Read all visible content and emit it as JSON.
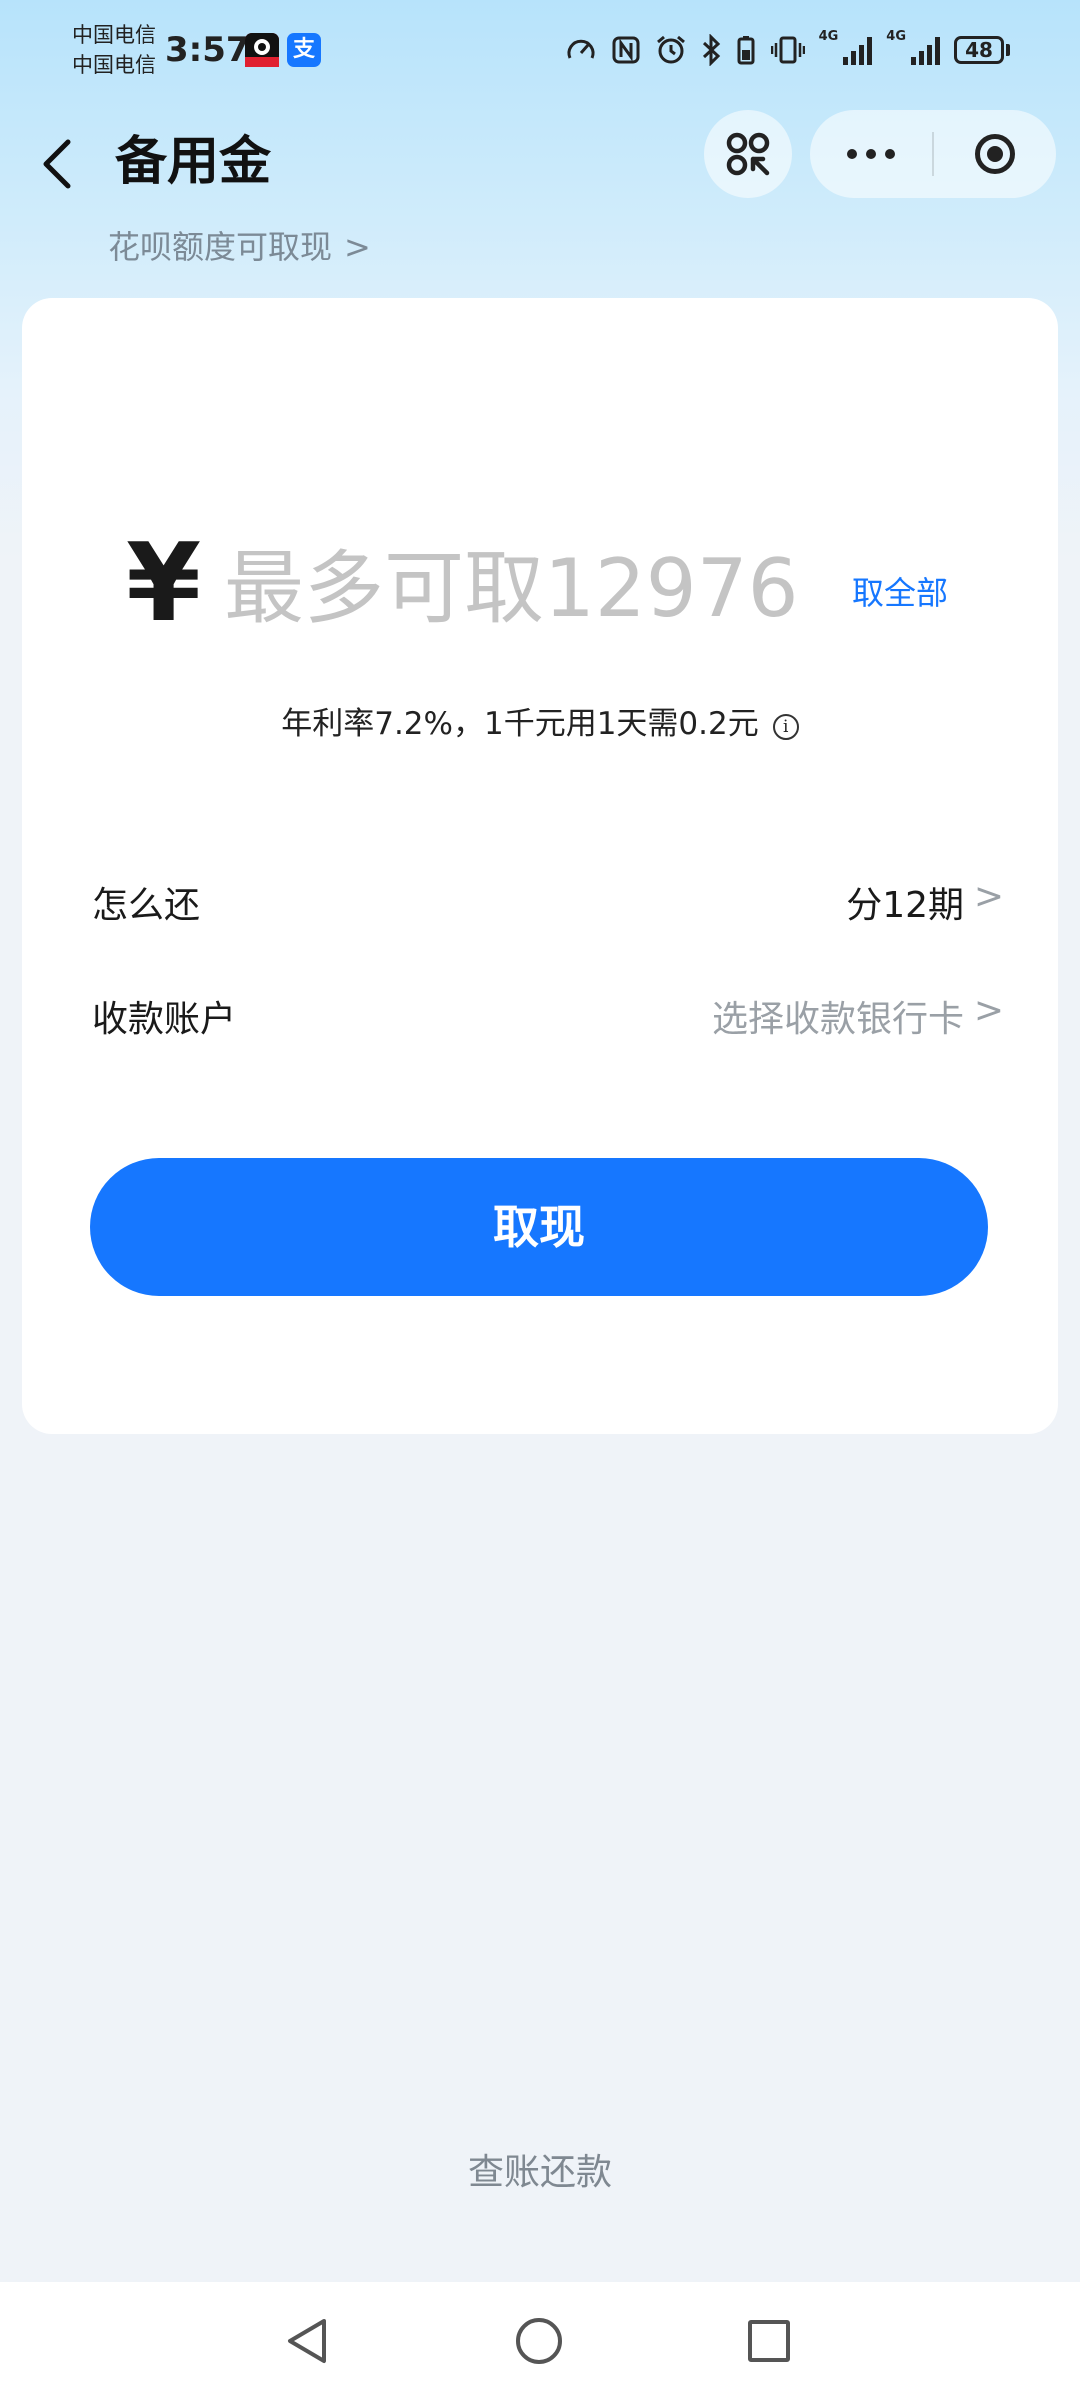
{
  "status_bar": {
    "carrier1": "中国电信",
    "carrier2": "中国电信",
    "time": "3:57",
    "app_icons": [
      "dingtalk-icon",
      "alipay-icon"
    ],
    "alipay_icon_char": "支",
    "network1": "4G",
    "network2": "4G",
    "battery": "48",
    "icons": [
      "speed-icon",
      "nfc-icon",
      "alarm-icon",
      "bluetooth-icon",
      "battery-saver-icon",
      "vibrate-icon",
      "signal-icon",
      "signal-icon",
      "battery-icon"
    ]
  },
  "nav": {
    "title": "备用金",
    "back_icon": "chevron-left-icon",
    "mini_program_icon": "mini-program-icon",
    "more_icon": "more-icon",
    "close_icon": "target-icon"
  },
  "sub_link": {
    "label": "花呗额度可取现",
    "chevron": ">"
  },
  "card": {
    "currency_symbol": "¥",
    "amount_placeholder": "最多可取12976",
    "amount_value": "",
    "take_all_label": "取全部",
    "rate_text": "年利率7.2%，1千元用1天需0.2元",
    "info_glyph": "i",
    "rows": [
      {
        "label": "怎么还",
        "value": "分12期",
        "chevron": ">"
      },
      {
        "label": "收款账户",
        "value": "选择收款银行卡",
        "chevron": ">"
      }
    ],
    "withdraw_label": "取现"
  },
  "bottom_link": "查账还款",
  "nav_bar": {
    "icons": [
      "back-triangle-icon",
      "home-circle-icon",
      "recent-square-icon"
    ]
  },
  "colors": {
    "accent": "#1677ff",
    "placeholder": "#c4c4c4",
    "secondary_text": "#9aa0a6",
    "background": "#eff3f8"
  }
}
